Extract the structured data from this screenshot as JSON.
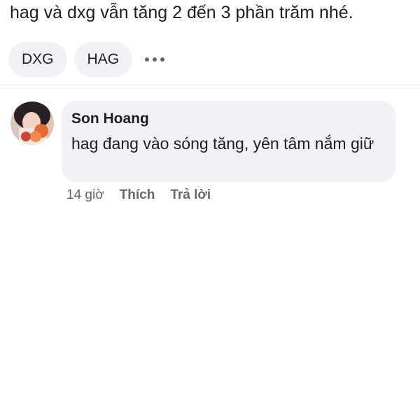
{
  "post": {
    "text": "hag và dxg vẫn tăng 2 đến 3 phần trăm nhé."
  },
  "tags": [
    "DXG",
    "HAG"
  ],
  "more_icon": "more-horizontal-icon",
  "comment": {
    "author": "Son Hoang",
    "text": "hag đang vào sóng tăng, yên tâm nắm giữ",
    "time": "14 giờ",
    "like_label": "Thích",
    "reply_label": "Trả lời"
  },
  "colors": {
    "bubble_bg": "#f0f2f5",
    "text_primary": "#1c1e21",
    "text_secondary": "#65676b",
    "divider": "#e4e6eb"
  }
}
